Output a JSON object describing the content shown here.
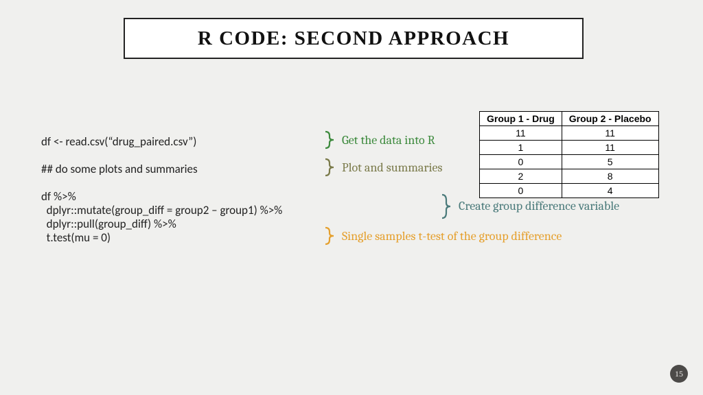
{
  "title": "R CODE: SECOND APPROACH",
  "code": {
    "line1": "df <- read.csv(“drug_paired.csv”)",
    "line2": "## do some plots and summaries",
    "line3": "df %>%",
    "line4": "  dplyr::mutate(group_diff = group2 – group1) %>%",
    "line5": "  dplyr::pull(group_diff) %>%",
    "line6": "  t.test(mu = 0)"
  },
  "annotations": {
    "a1": "Get the data into R",
    "a2": "Plot and summaries",
    "a3": "Create group difference variable",
    "a4": "Single samples t-test of the group difference"
  },
  "colors": {
    "green": "#3d8a3d",
    "olive": "#7a7a4a",
    "teal": "#4a7a7a",
    "orange": "#e5a02e"
  },
  "table": {
    "headers": [
      "Group 1 - Drug",
      "Group 2 - Placebo"
    ],
    "rows": [
      [
        "11",
        "11"
      ],
      [
        "1",
        "11"
      ],
      [
        "0",
        "5"
      ],
      [
        "2",
        "8"
      ],
      [
        "0",
        "4"
      ]
    ]
  },
  "page": "15"
}
